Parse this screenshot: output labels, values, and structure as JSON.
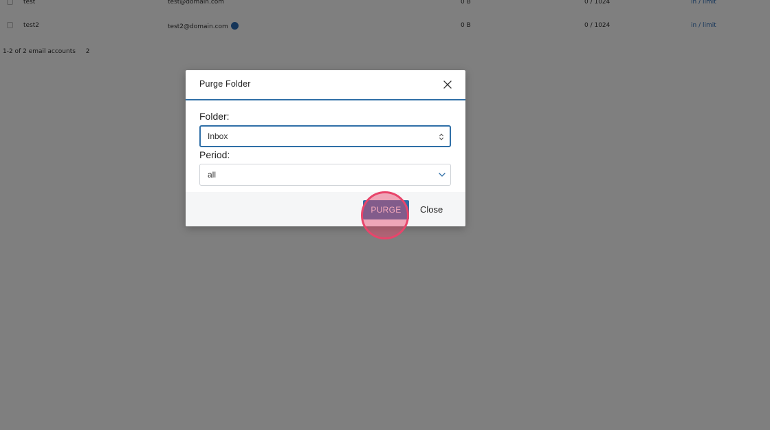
{
  "background": {
    "rows": [
      {
        "name": "test",
        "email": "test@domain.com",
        "count": "0 B",
        "size": "0 / 1024",
        "link": "in / limit",
        "info": false
      },
      {
        "name": "test2",
        "email": "test2@domain.com",
        "count": "0 B",
        "size": "0 / 1024",
        "link": "in / limit",
        "info": true
      }
    ],
    "footer": {
      "summary": "1-2 of 2 email accounts",
      "count": "2"
    }
  },
  "modal": {
    "title": "Purge Folder",
    "close_icon": "close-icon",
    "folder_label": "Folder:",
    "folder_value": "Inbox",
    "period_label": "Period:",
    "period_value": "all",
    "purge_label": "PURGE",
    "close_label": "Close"
  },
  "colors": {
    "accent": "#2f6fa7",
    "click_highlight": "#e8456b"
  }
}
